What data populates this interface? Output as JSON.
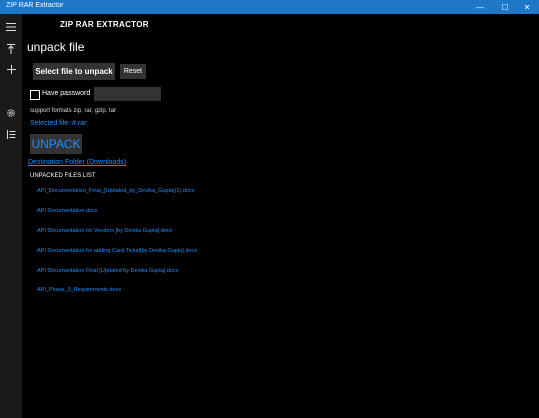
{
  "window": {
    "title": "ZIP RAR Extractor",
    "controls": [
      "—",
      "☐",
      "✕"
    ]
  },
  "sidebar": {
    "icons": [
      "menu-icon",
      "upload-icon",
      "add-icon",
      "settings-icon",
      "list-icon"
    ]
  },
  "app": {
    "name": "ZIP RAR EXTRACTOR"
  },
  "page": {
    "heading": "unpack file",
    "select_button": "Select file to unpack",
    "reset_button": "Reset",
    "have_password_label": "Have password",
    "password_value": "",
    "formats": "support formats zip, rar, gzip, tar",
    "selected_file": "Selected file: #.rar",
    "unpack_button": "UNPACK",
    "destination": "Destination Folder (Downloads)",
    "unpacked_title": "UNPACKED FILES LIST",
    "files": [
      "API_Documentation_Final_[Updated_by_Devika_Gupta](1).docx",
      "API Documentation.docx",
      "API Documentation for Vendors [by Devika Gupta].docx",
      "API Documentation for adding Card-Ticket[by Devika Gupta].docx",
      "API Documentation Final [Updated by Devika Gupta].docx",
      "API_Phase_3_Requirements.docx"
    ]
  }
}
